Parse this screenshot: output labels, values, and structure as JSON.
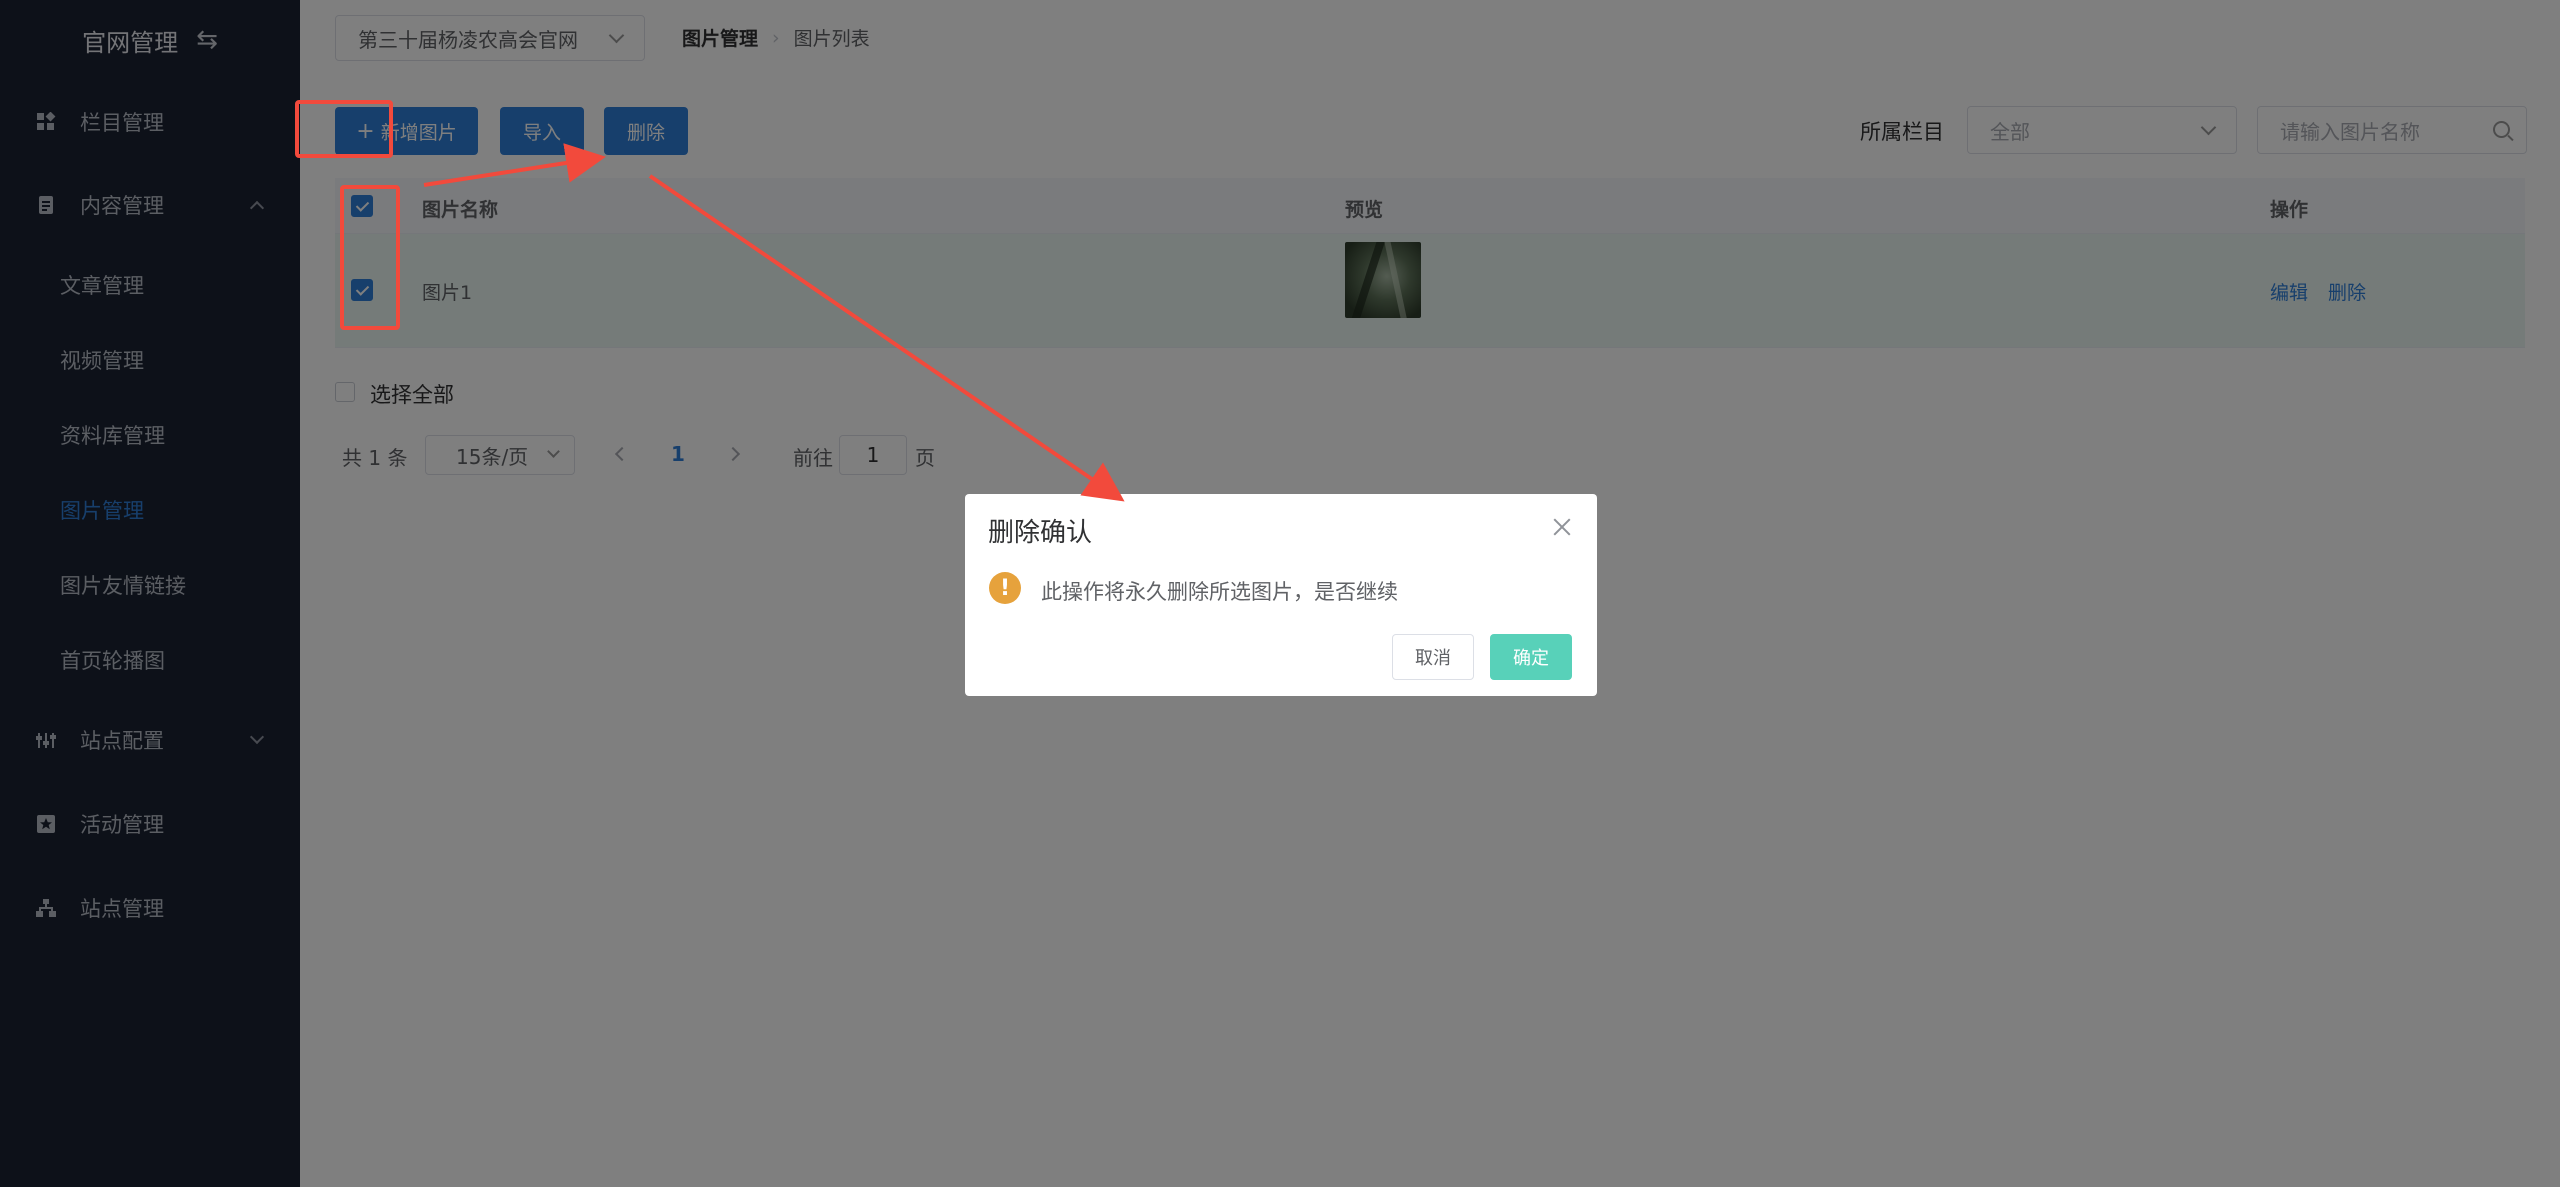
{
  "sidebar": {
    "title": "官网管理",
    "items": [
      {
        "label": "栏目管理"
      },
      {
        "label": "内容管理"
      },
      {
        "label": "站点配置"
      },
      {
        "label": "活动管理"
      },
      {
        "label": "站点管理"
      }
    ],
    "content_sub": [
      {
        "label": "文章管理"
      },
      {
        "label": "视频管理"
      },
      {
        "label": "资料库管理"
      },
      {
        "label": "图片管理"
      },
      {
        "label": "图片友情链接"
      },
      {
        "label": "首页轮播图"
      }
    ]
  },
  "header": {
    "site": "第三十届杨凌农高会官网",
    "breadcrumb": [
      "图片管理",
      "图片列表"
    ]
  },
  "toolbar": {
    "add": "新增图片",
    "import": "导入",
    "delete": "删除",
    "filter_label": "所属栏目",
    "filter_value": "全部",
    "search_placeholder": "请输入图片名称"
  },
  "table": {
    "columns": [
      "图片名称",
      "预览",
      "操作"
    ],
    "rows": [
      {
        "name": "图片1",
        "actions": [
          "编辑",
          "删除"
        ],
        "selected": true
      }
    ],
    "header_selected": true
  },
  "select_all": "选择全部",
  "pagination": {
    "total": "共 1 条",
    "page_size": "15条/页",
    "current": "1",
    "goto_label": "前往",
    "goto_value": "1",
    "page_suffix": "页"
  },
  "dialog": {
    "title": "删除确认",
    "message": "此操作将永久删除所选图片，是否继续",
    "cancel": "取消",
    "confirm": "确定"
  },
  "colors": {
    "sidebar_bg": "#1b2232",
    "primary": "#2f7ed8",
    "confirm": "#58d1b9",
    "warning": "#e6a23c",
    "annotation": "#f24a3c"
  }
}
